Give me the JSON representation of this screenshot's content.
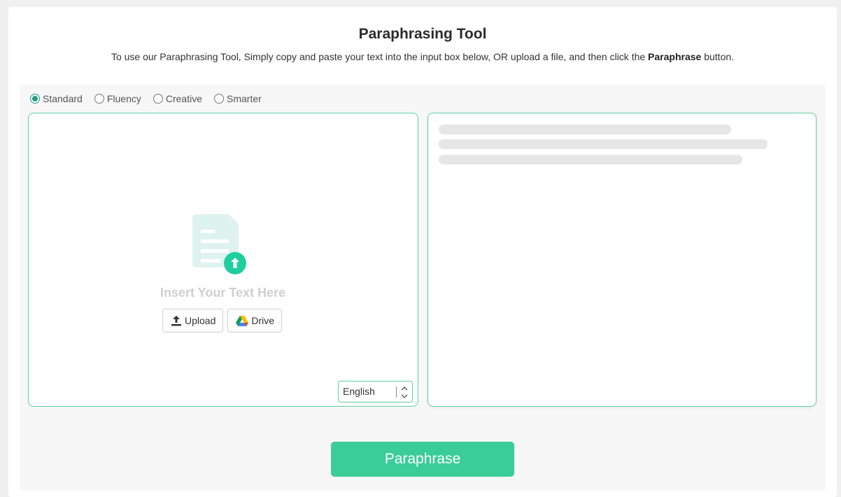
{
  "header": {
    "title": "Paraphrasing Tool",
    "subtitle_prefix": "To use our Paraphrasing Tool, Simply copy and paste your text into the input box below, OR upload a file, and then click the ",
    "subtitle_bold": "Paraphrase",
    "subtitle_suffix": " button."
  },
  "modes": [
    {
      "label": "Standard",
      "selected": true
    },
    {
      "label": "Fluency",
      "selected": false
    },
    {
      "label": "Creative",
      "selected": false
    },
    {
      "label": "Smarter",
      "selected": false
    }
  ],
  "input_panel": {
    "placeholder": "Insert Your Text Here",
    "upload_label": "Upload",
    "drive_label": "Drive",
    "icon": "document-upload-icon",
    "language": "English"
  },
  "output_panel": {
    "state": "loading-skeleton"
  },
  "actions": {
    "paraphrase_label": "Paraphrase"
  },
  "colors": {
    "accent": "#3acd98",
    "border": "#5fd0a4",
    "radio_selected": "#1f9c83",
    "icon_light": "#dff3ee",
    "icon_dark": "#1fcfa0"
  }
}
